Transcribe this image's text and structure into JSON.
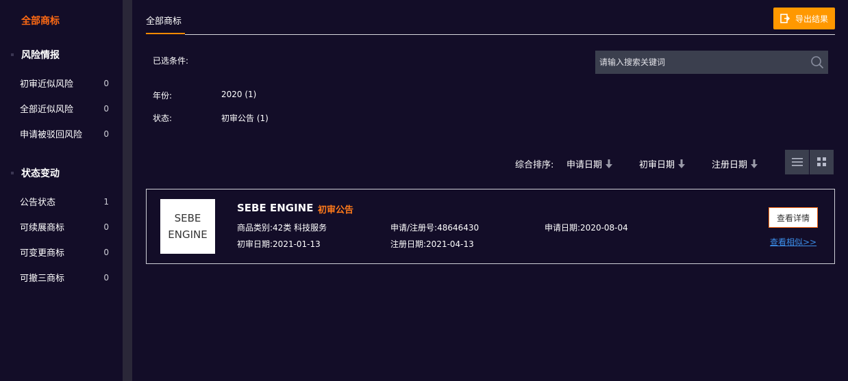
{
  "sidebar": {
    "all_label": "全部商标",
    "sections": [
      {
        "title": "风险情报",
        "items": [
          {
            "label": "初审近似风险",
            "count": "0"
          },
          {
            "label": "全部近似风险",
            "count": "0"
          },
          {
            "label": "申请被驳回风险",
            "count": "0"
          }
        ]
      },
      {
        "title": "状态变动",
        "items": [
          {
            "label": "公告状态",
            "count": "1"
          },
          {
            "label": "可续展商标",
            "count": "0"
          },
          {
            "label": "可变更商标",
            "count": "0"
          },
          {
            "label": "可撤三商标",
            "count": "0"
          }
        ]
      }
    ]
  },
  "main": {
    "tab_label": "全部商标",
    "export_label": "导出结果",
    "selected_label": "已选条件:",
    "search_placeholder": "请输入搜索关键词",
    "filters": [
      {
        "label": "年份:",
        "value": "2020 (1)"
      },
      {
        "label": "状态:",
        "value": "初审公告 (1)"
      }
    ],
    "sort": {
      "label": "综合排序:",
      "options": [
        "申请日期",
        "初审日期",
        "注册日期"
      ]
    }
  },
  "result": {
    "logo_line1": "SEBE",
    "logo_line2": "ENGINE",
    "name": "SEBE ENGINE",
    "status": "初审公告",
    "category": "商品类别:42类 科技服务",
    "reg_no": "申请/注册号:48646430",
    "apply_date": "申请日期:2020-08-04",
    "prelim_date": "初审日期:2021-01-13",
    "register_date": "注册日期:2021-04-13",
    "detail_label": "查看详情",
    "similar_label": "查看相似>>"
  },
  "colors": {
    "background": "#130d28",
    "accent": "#ff6a13",
    "export": "#ff9800",
    "link": "#3b8de8"
  }
}
